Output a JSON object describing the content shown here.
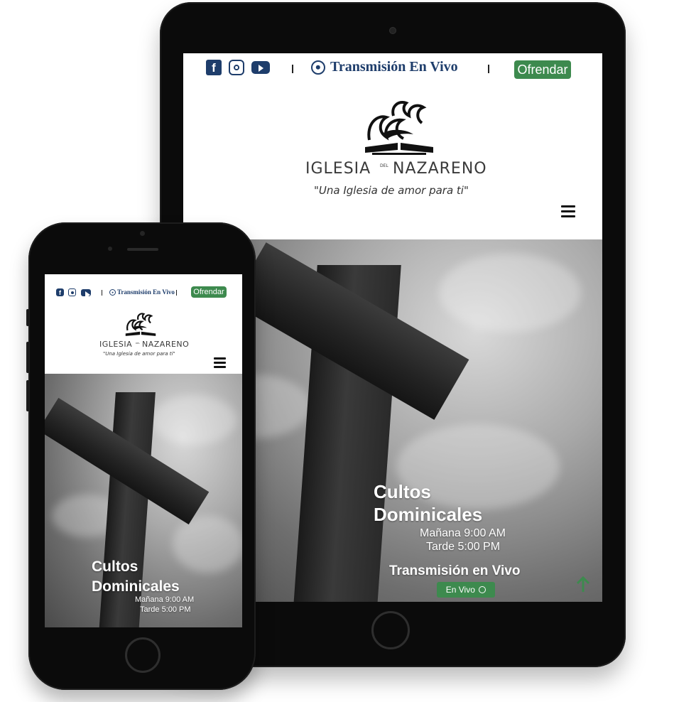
{
  "site": {
    "live_label": "Transmisión En Vivo",
    "offer_button": "Ofrendar",
    "logo_name_left": "IGLESIA",
    "logo_name_small": "DEL",
    "logo_name_right": "NAZARENO",
    "logo_tagline": "\"Una Iglesia de amor para ti\"",
    "social_icons": [
      "facebook-icon",
      "instagram-icon",
      "youtube-icon"
    ]
  },
  "hero": {
    "title_line1": "Cultos",
    "title_line2": "Dominicales",
    "morning": "Mañana 9:00 AM",
    "evening": "Tarde 5:00 PM",
    "live_heading": "Transmisión en Vivo",
    "live_button": "En Vivo"
  },
  "colors": {
    "brand_blue": "#1e3d6b",
    "accent_green": "#3d8a4e",
    "scroll_arrow": "#3d8a4e"
  }
}
